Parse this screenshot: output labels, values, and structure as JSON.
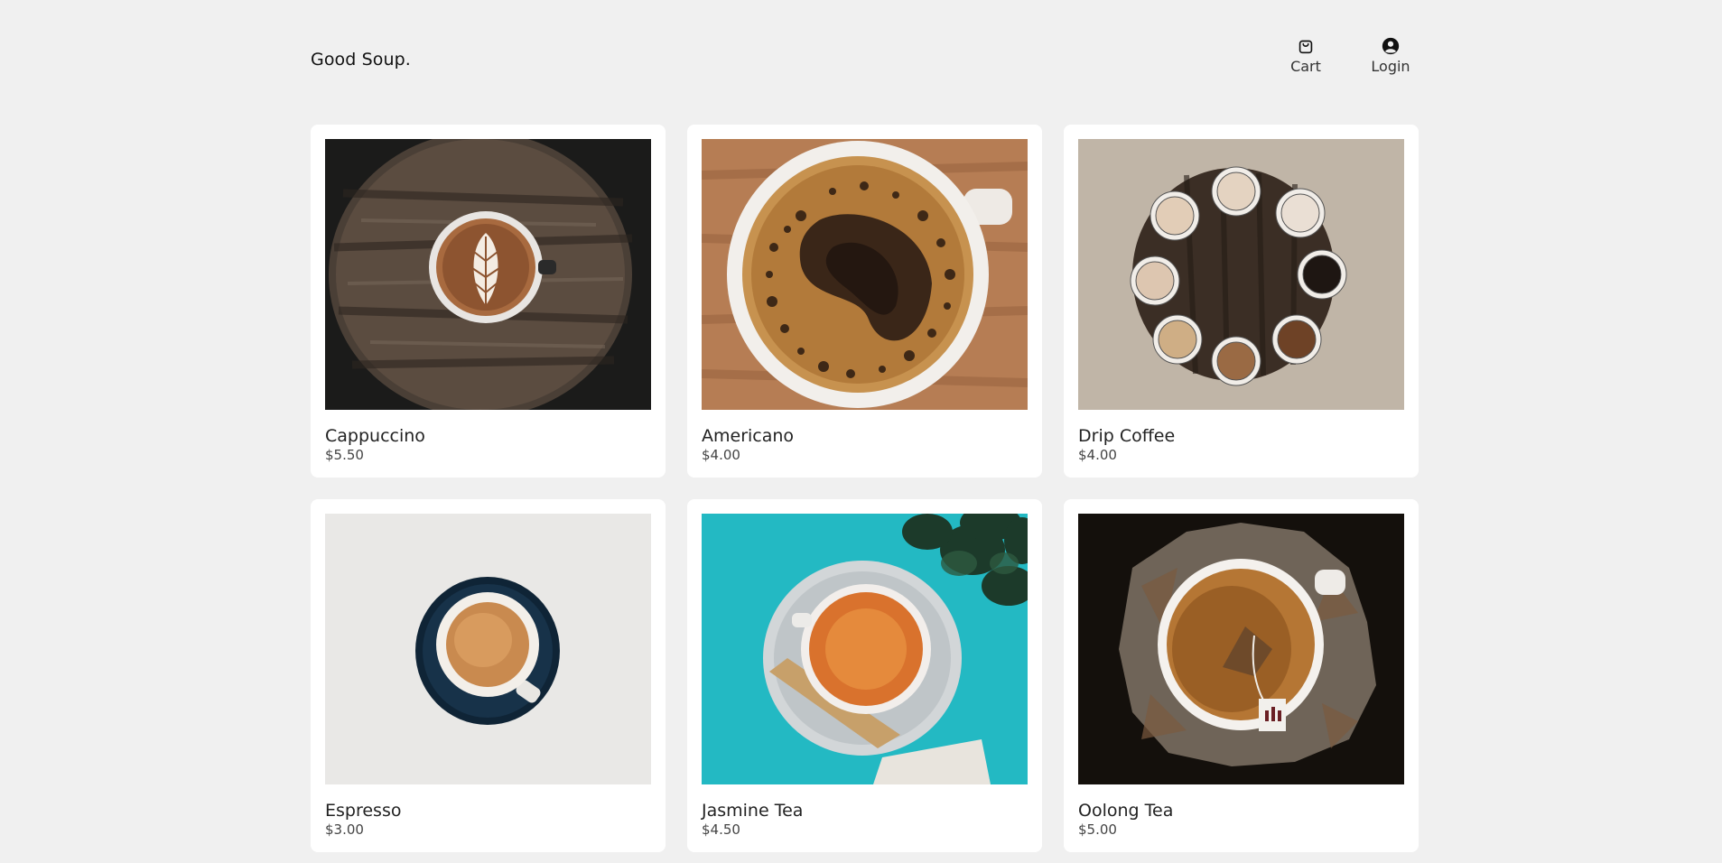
{
  "header": {
    "brand": "Good Soup.",
    "nav": [
      {
        "label": "Cart",
        "icon": "shopping-bag-icon"
      },
      {
        "label": "Login",
        "icon": "user-circle-icon"
      }
    ]
  },
  "products": [
    {
      "name": "Cappuccino",
      "price": "$5.50",
      "image": "cappuccino-latte-art-on-wooden-table"
    },
    {
      "name": "Americano",
      "price": "$4.00",
      "image": "americano-cup-on-wood"
    },
    {
      "name": "Drip Coffee",
      "price": "$4.00",
      "image": "ring-of-coffee-cups-on-table"
    },
    {
      "name": "Espresso",
      "price": "$3.00",
      "image": "espresso-cup-on-navy-saucer"
    },
    {
      "name": "Jasmine Tea",
      "price": "$4.50",
      "image": "tea-cup-on-turquoise-surface"
    },
    {
      "name": "Oolong Tea",
      "price": "$5.00",
      "image": "tea-cup-with-tea-bag-dark-background"
    }
  ],
  "colors": {
    "background": "#f0f0f0",
    "card": "#ffffff",
    "text": "#1a1a1a"
  }
}
